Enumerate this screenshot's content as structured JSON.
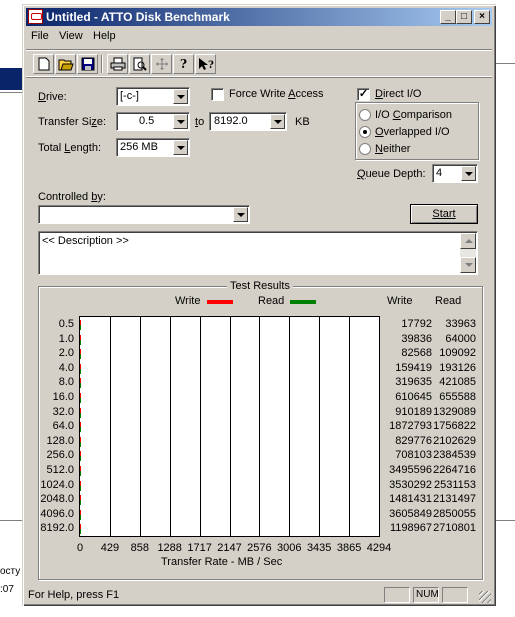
{
  "window": {
    "title": "Untitled - ATTO Disk Benchmark"
  },
  "menu": {
    "file": "File",
    "view": "View",
    "help": "Help"
  },
  "background": {
    "text1": "осту",
    "text2": ":07"
  },
  "toolbar": {
    "icons": [
      "new-icon",
      "open-icon",
      "save-icon",
      "print-icon",
      "print-preview-icon",
      "move-icon",
      "help-icon",
      "context-help-icon"
    ]
  },
  "form": {
    "drive_label": "Drive:",
    "drive_value": "[-c-]",
    "force_write_label": "Force Write Access",
    "force_write_checked": false,
    "transfer_label": "Transfer Size:",
    "transfer_from": "0.5",
    "to_label": "to",
    "transfer_to": "8192.0",
    "kb_label": "KB",
    "total_label": "Total Length:",
    "total_value": "256 MB",
    "direct_io_label": "Direct I/O",
    "direct_io_checked": true,
    "io_comparison_label": "I/O Comparison",
    "overlapped_io_label": "Overlapped I/O",
    "neither_label": "Neither",
    "selected_mode": "Overlapped I/O",
    "queue_label": "Queue Depth:",
    "queue_value": "4",
    "controlled_label": "Controlled by:",
    "controlled_value": "",
    "start_label": "Start",
    "description": "<< Description >>"
  },
  "results": {
    "group_title": "Test Results",
    "write_legend": "Write",
    "read_legend": "Read",
    "write_header": "Write",
    "read_header": "Read",
    "colors": {
      "write": "#ff0000",
      "read": "#008000"
    }
  },
  "chart_data": {
    "type": "bar",
    "orientation": "horizontal",
    "categories": [
      "0.5",
      "1.0",
      "2.0",
      "4.0",
      "8.0",
      "16.0",
      "32.0",
      "64.0",
      "128.0",
      "256.0",
      "512.0",
      "1024.0",
      "2048.0",
      "4096.0",
      "8192.0"
    ],
    "series": [
      {
        "name": "Write",
        "values": [
          17792,
          39836,
          82568,
          159419,
          319635,
          610645,
          910189,
          1872793,
          829776,
          708103,
          3495596,
          3530292,
          1481431,
          3605849,
          1198967
        ]
      },
      {
        "name": "Read",
        "values": [
          33963,
          64000,
          109092,
          193126,
          421085,
          655588,
          1329089,
          1756822,
          2102629,
          2384539,
          2264716,
          2531153,
          2131497,
          2850055,
          2710801
        ]
      }
    ],
    "x_ticks": [
      "0",
      "429",
      "858",
      "1288",
      "1717",
      "2147",
      "2576",
      "3006",
      "3435",
      "3865",
      "4294"
    ],
    "xlim": [
      0,
      4294
    ],
    "xlabel": "Transfer Rate - MB / Sec",
    "legend": "top",
    "grid": true
  },
  "status": {
    "help_text": "For Help, press F1",
    "num": "NUM"
  }
}
